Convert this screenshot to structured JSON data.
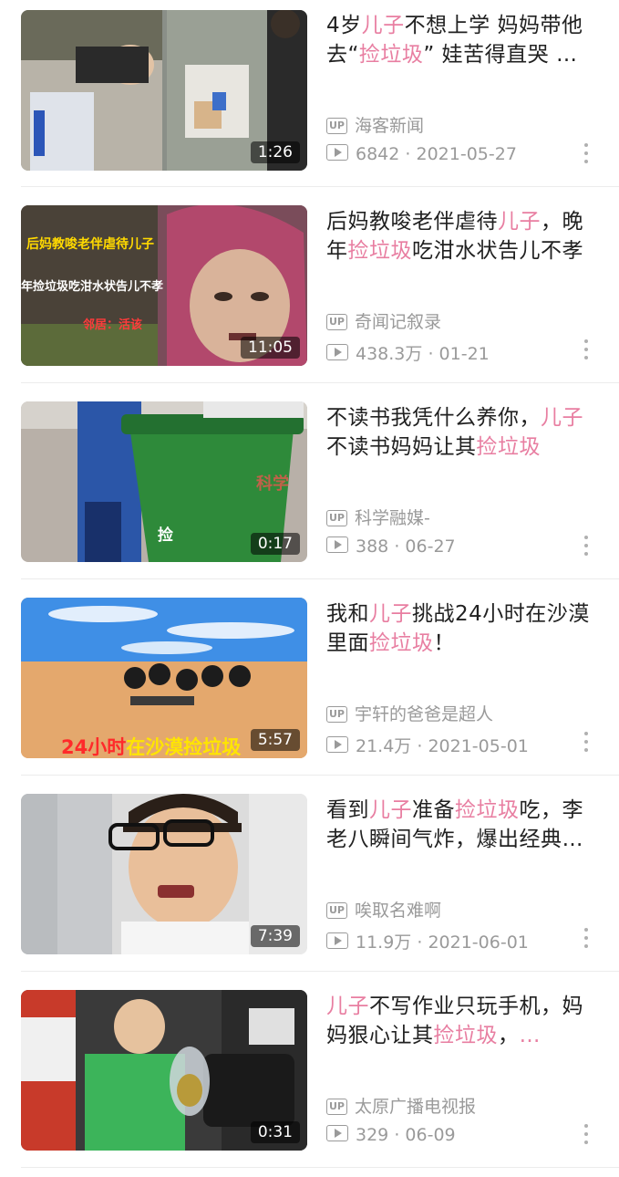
{
  "videos": [
    {
      "title_parts": [
        [
          "4岁",
          false
        ],
        [
          "儿子",
          true
        ],
        [
          "不想上学 妈妈带他去“",
          false
        ],
        [
          "捡垃圾",
          true
        ],
        [
          "” 娃苦得直哭 以后不敢了",
          false
        ]
      ],
      "author": "海客新闻",
      "views": "6842",
      "date": "2021-05-27",
      "duration": "1:26",
      "thumb_text": ""
    },
    {
      "title_parts": [
        [
          "后妈教唆老伴虐待",
          false
        ],
        [
          "儿子",
          true
        ],
        [
          "，晚年",
          false
        ],
        [
          "捡垃圾",
          true
        ],
        [
          "吃泔水状告儿不孝",
          false
        ]
      ],
      "author": "奇闻记叙录",
      "views": "438.3万",
      "date": "01-21",
      "duration": "11:05",
      "thumb_text_1": "后妈教唆老伴虐待儿子",
      "thumb_text_2": "年捡垃圾吃泔水状告儿不孝",
      "thumb_text_3": "邻居：活该"
    },
    {
      "title_parts": [
        [
          "不读书我凭什么养你，",
          false
        ],
        [
          "儿子",
          true
        ],
        [
          "不读书妈妈让其",
          false
        ],
        [
          "捡垃圾",
          true
        ]
      ],
      "author": "科学融媒-",
      "views": "388",
      "date": "06-27",
      "duration": "0:17",
      "thumb_text": "捡",
      "thumb_watermark": "科学"
    },
    {
      "title_parts": [
        [
          "我和",
          false
        ],
        [
          "儿子",
          true
        ],
        [
          "挑战24小时在沙漠里面",
          false
        ],
        [
          "捡垃圾",
          true
        ],
        [
          "！",
          false
        ]
      ],
      "author": "宇轩的爸爸是超人",
      "views": "21.4万",
      "date": "2021-05-01",
      "duration": "5:57",
      "thumb_text_red": "24小时",
      "thumb_text_yellow": "在沙漠捡垃圾"
    },
    {
      "title_parts": [
        [
          "看到",
          false
        ],
        [
          "儿子",
          true
        ],
        [
          "准备",
          false
        ],
        [
          "捡垃圾",
          true
        ],
        [
          "吃，李老八瞬间气炸，爆出经典名言",
          false
        ]
      ],
      "author": "唉取名难啊",
      "views": "11.9万",
      "date": "2021-06-01",
      "duration": "7:39"
    },
    {
      "title_parts": [
        [
          "儿子",
          true
        ],
        [
          "不写作业只玩手机，妈妈狠心让其",
          false
        ],
        [
          "捡垃圾",
          true
        ],
        [
          "，",
          false
        ],
        [
          "…",
          true
        ]
      ],
      "author": "太原广播电视报",
      "views": "329",
      "date": "06-09",
      "duration": "0:31"
    }
  ],
  "up_label": "UP",
  "dot_sep": "·",
  "colors": {
    "highlight": "#e87ea1",
    "meta": "#9a9a9a",
    "title": "#212121"
  },
  "icons": {
    "up": "up-badge-icon",
    "play": "play-count-icon",
    "more": "more-vertical-icon"
  }
}
